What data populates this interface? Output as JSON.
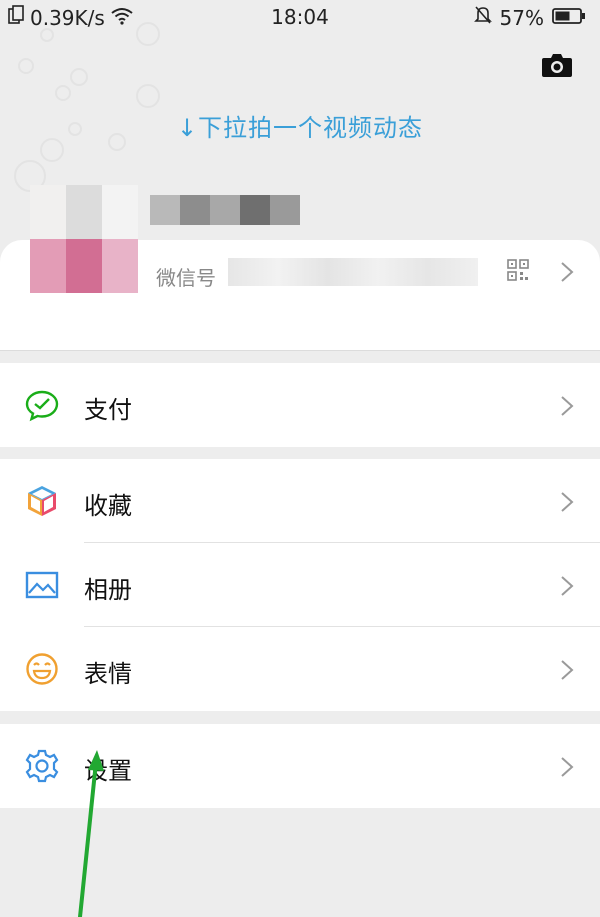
{
  "status": {
    "speed": "0.39K/s",
    "time": "18:04",
    "battery": "57%"
  },
  "header": {
    "pull_hint": "↓下拉拍一个视频动态"
  },
  "profile": {
    "wechat_id_label": "微信号"
  },
  "menu": {
    "pay": "支付",
    "favorites": "收藏",
    "album": "相册",
    "stickers": "表情",
    "settings": "设置"
  },
  "colors": {
    "accent_blue": "#3a9fd8",
    "wechat_green": "#1aad19",
    "annotation_arrow": "#22a832"
  }
}
